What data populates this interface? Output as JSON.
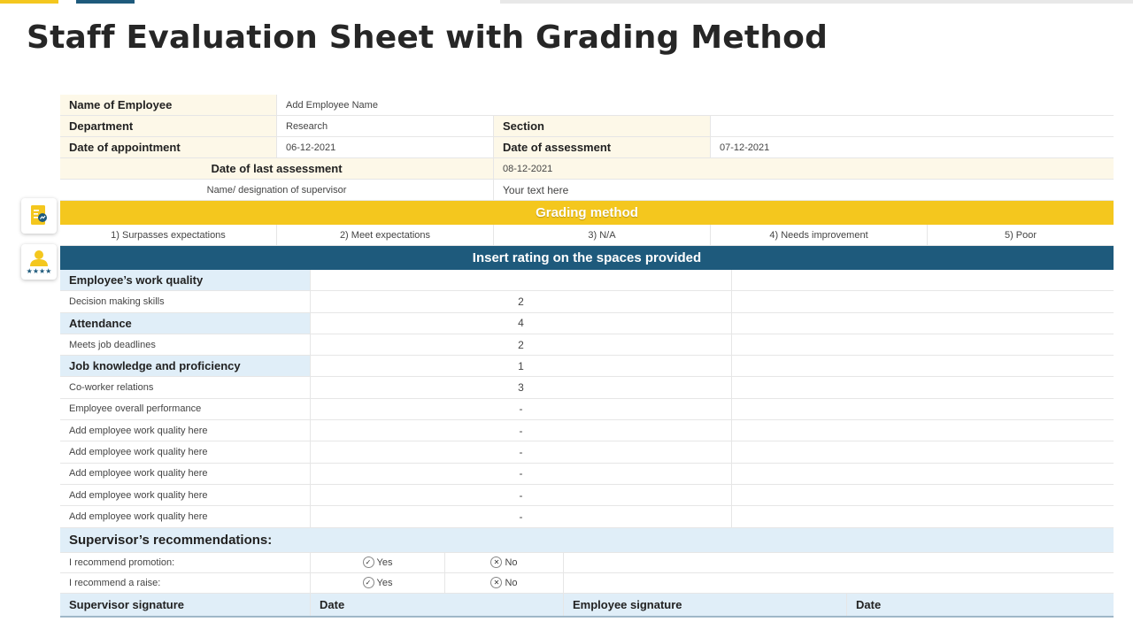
{
  "title": "Staff Evaluation Sheet with Grading Method",
  "colors": {
    "yellow": "#f4c71e",
    "navy": "#1e5a7c",
    "light_blue": "#e0eef8",
    "cream": "#fdf8e8"
  },
  "icons": [
    "document-chart-icon",
    "employee-rating-icon"
  ],
  "info": {
    "name_label": "Name of Employee",
    "name_value": "Add Employee  Name",
    "department_label": "Department",
    "department_value": "Research",
    "section_label": "Section",
    "section_value": "",
    "appointment_label": "Date of appointment",
    "appointment_value": "06-12-2021",
    "assessment_label": "Date of assessment",
    "assessment_value": "07-12-2021",
    "last_assessment_label": "Date of last assessment",
    "last_assessment_value": "08-12-2021",
    "supervisor_label": "Name/ designation of supervisor",
    "supervisor_value": "Your text here"
  },
  "grading": {
    "title": "Grading method",
    "levels": [
      "1) Surpasses expectations",
      "2) Meet expectations",
      "3) N/A",
      "4) Needs improvement",
      "5) Poor"
    ]
  },
  "ratings": {
    "title": "Insert rating on the spaces provided",
    "rows": [
      {
        "label": "Employee’s work quality",
        "value": "",
        "header": true
      },
      {
        "label": "Decision making skills",
        "value": "2",
        "header": false
      },
      {
        "label": "Attendance",
        "value": "4",
        "header": true
      },
      {
        "label": "Meets job deadlines",
        "value": "2",
        "header": false
      },
      {
        "label": "Job knowledge and proficiency",
        "value": "1",
        "header": true
      },
      {
        "label": "Co-worker relations",
        "value": "3",
        "header": false
      },
      {
        "label": "Employee  overall performance",
        "value": "-",
        "header": false
      },
      {
        "label": "Add employee  work quality here",
        "value": "-",
        "header": false
      },
      {
        "label": "Add employee  work quality here",
        "value": "-",
        "header": false
      },
      {
        "label": "Add employee  work quality here",
        "value": "-",
        "header": false
      },
      {
        "label": "Add employee  work quality here",
        "value": "-",
        "header": false
      },
      {
        "label": "Add employee  work quality here",
        "value": "-",
        "header": false
      }
    ]
  },
  "recommendations": {
    "title": "Supervisor’s recommendations:",
    "promotion_label": "I recommend promotion:",
    "raise_label": "I recommend a raise:",
    "yes": "Yes",
    "no": "No"
  },
  "signatures": {
    "supervisor": "Supervisor signature",
    "date1": "Date",
    "employee": "Employee signature",
    "date2": "Date"
  }
}
